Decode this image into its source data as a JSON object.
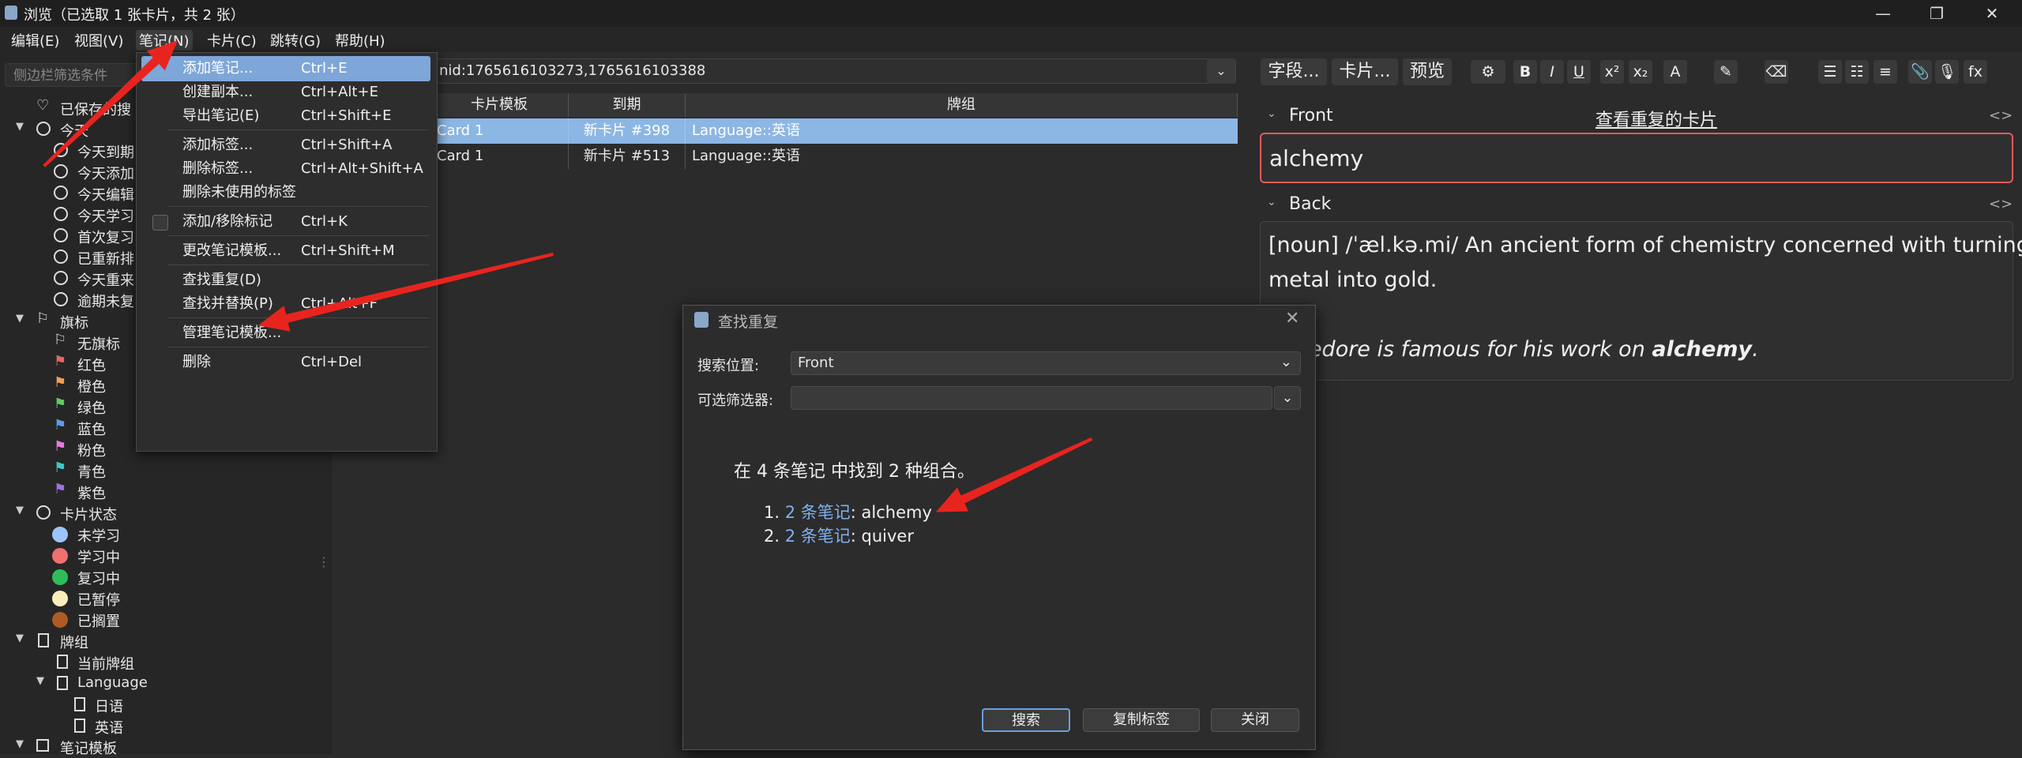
{
  "window": {
    "title": "浏览（已选取 1 张卡片，共 2 张）",
    "controls": [
      "minimize-icon",
      "restore-icon",
      "close-icon"
    ]
  },
  "menubar": {
    "items": [
      "编辑(E)",
      "视图(V)",
      "笔记(N)",
      "卡片(C)",
      "跳转(G)",
      "帮助(H)"
    ],
    "active": "笔记(N)"
  },
  "sidebar": {
    "search_placeholder": "侧边栏筛选条件",
    "saved": "已保存的搜",
    "today": {
      "label": "今天",
      "items": [
        "今天到期",
        "今天添加",
        "今天编辑",
        "今天学习",
        "首次复习",
        "已重新排",
        "今天重来",
        "逾期未复"
      ]
    },
    "flags": {
      "label": "旗标",
      "items": [
        {
          "label": "无旗标",
          "color": "#dddddd"
        },
        {
          "label": "红色",
          "color": "#e66464"
        },
        {
          "label": "橙色",
          "color": "#f0a050"
        },
        {
          "label": "绿色",
          "color": "#5ccf5c"
        },
        {
          "label": "蓝色",
          "color": "#5c9cf0"
        },
        {
          "label": "粉色",
          "color": "#e878e8"
        },
        {
          "label": "青色",
          "color": "#3cc8c8"
        },
        {
          "label": "紫色",
          "color": "#a070e0"
        }
      ]
    },
    "card_state": {
      "label": "卡片状态",
      "items": [
        {
          "label": "未学习",
          "color": "#9cc4f8"
        },
        {
          "label": "学习中",
          "color": "#f07070"
        },
        {
          "label": "复习中",
          "color": "#2fbd5c"
        },
        {
          "label": "已暂停",
          "color": "#f8f0b8"
        },
        {
          "label": "已搁置",
          "color": "#b05a24"
        }
      ]
    },
    "decks": {
      "label": "牌组",
      "current": "当前牌组",
      "parent": "Language",
      "children": [
        "日语",
        "英语"
      ]
    },
    "note_types": "笔记模板"
  },
  "search": {
    "query": "nid:1765616103273,1765616103388"
  },
  "table": {
    "columns": [
      "卡片模板",
      "到期",
      "牌组"
    ],
    "rows": [
      {
        "template": "Card 1",
        "due": "新卡片 #398",
        "deck": "Language::英语",
        "selected": true
      },
      {
        "template": "Card 1",
        "due": "新卡片 #513",
        "deck": "Language::英语",
        "selected": false
      }
    ]
  },
  "notes_menu": {
    "items": [
      {
        "label": "添加笔记...",
        "shortcut": "Ctrl+E",
        "highlighted": true
      },
      {
        "label": "创建副本...",
        "shortcut": "Ctrl+Alt+E"
      },
      {
        "label": "导出笔记(E)",
        "shortcut": "Ctrl+Shift+E"
      },
      {
        "sep": true
      },
      {
        "label": "添加标签...",
        "shortcut": "Ctrl+Shift+A"
      },
      {
        "label": "删除标签...",
        "shortcut": "Ctrl+Alt+Shift+A"
      },
      {
        "label": "删除未使用的标签",
        "shortcut": ""
      },
      {
        "sep": true
      },
      {
        "label": "添加/移除标记",
        "shortcut": "Ctrl+K",
        "checkbox": true
      },
      {
        "sep": true
      },
      {
        "label": "更改笔记模板...",
        "shortcut": "Ctrl+Shift+M"
      },
      {
        "sep": true
      },
      {
        "label": "查找重复(D)",
        "shortcut": ""
      },
      {
        "label": "查找并替换(P)",
        "shortcut": "Ctrl+Alt+F"
      },
      {
        "sep": true
      },
      {
        "label": "管理笔记模板...",
        "shortcut": ""
      },
      {
        "sep": true
      },
      {
        "label": "删除",
        "shortcut": "Ctrl+Del"
      }
    ]
  },
  "editor": {
    "toolbar": {
      "fields": "字段...",
      "cards": "卡片...",
      "preview": "预览"
    },
    "format_icons": [
      "gear-icon",
      "bold-icon",
      "italic-icon",
      "underline-icon",
      "superscript-icon",
      "subscript-icon",
      "text-color-icon",
      "highlight-icon",
      "eraser-icon",
      "bullet-list-icon",
      "numbered-list-icon",
      "align-icon",
      "attachment-icon",
      "microphone-icon",
      "formula-icon"
    ],
    "front_label": "Front",
    "show_duplicates": "查看重复的卡片",
    "front_value": "alchemy",
    "back_label": "Back",
    "back_line1": "[noun] /ˈæl.kə.mi/ An ancient form of chemistry concerned with turning",
    "back_line2": "metal into gold.",
    "back_example_pre": "mbledore is famous for his work on ",
    "back_example_bold": "alchemy",
    "back_example_post": "."
  },
  "dialog": {
    "title": "查找重复",
    "search_in_label": "搜索位置:",
    "search_in_value": "Front",
    "filter_label": "可选筛选器:",
    "filter_value": "",
    "result_summary": "在 4 条笔记 中找到 2 种组合。",
    "results": [
      {
        "index": "1.",
        "link": "2 条笔记",
        "text": ": alchemy"
      },
      {
        "index": "2.",
        "link": "2 条笔记",
        "text": ": quiver"
      }
    ],
    "buttons": {
      "search": "搜索",
      "copy_tags": "复制标签",
      "close": "关闭"
    }
  },
  "colors": {
    "accent_arrow": "#e8241f",
    "selection": "#8cb6e4",
    "link": "#7fb1f0",
    "error_border": "#e45a5a"
  }
}
